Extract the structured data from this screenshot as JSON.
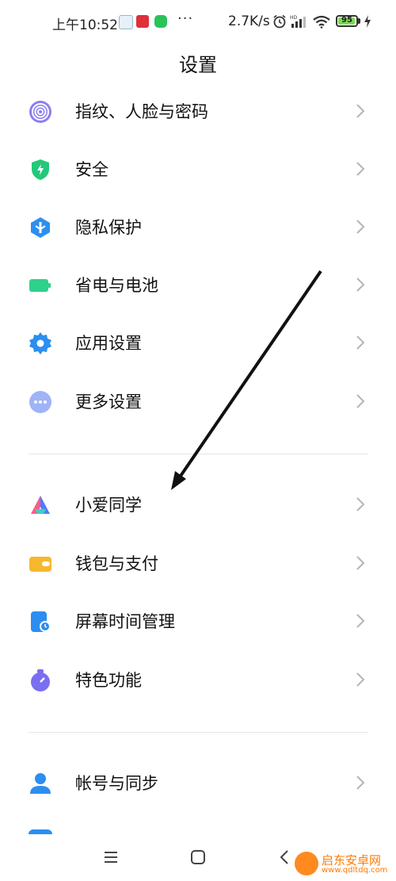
{
  "status_bar": {
    "time": "上午10:52",
    "net_speed": "2.7K/s",
    "dots": "···",
    "battery_level": "95",
    "battery_fraction": 0.95
  },
  "title": "设置",
  "groups": [
    {
      "items": [
        {
          "label": "指纹、人脸与密码",
          "icon": "fingerprint-icon",
          "color": "#7b6fe0"
        },
        {
          "label": "安全",
          "icon": "shield-icon",
          "color": "#23c87a"
        },
        {
          "label": "隐私保护",
          "icon": "privacy-icon",
          "color": "#2d8ff0"
        },
        {
          "label": "省电与电池",
          "icon": "battery-icon",
          "color": "#2ed18a"
        },
        {
          "label": "应用设置",
          "icon": "gear-icon",
          "color": "#2b8ef0"
        },
        {
          "label": "更多设置",
          "icon": "more-icon",
          "color": "#8fa5f5"
        }
      ]
    },
    {
      "items": [
        {
          "label": "小爱同学",
          "icon": "xiaoai-icon",
          "color": "#4f7cff"
        },
        {
          "label": "钱包与支付",
          "icon": "wallet-icon",
          "color": "#f5b82e"
        },
        {
          "label": "屏幕时间管理",
          "icon": "screen-time-icon",
          "color": "#2b8ef0"
        },
        {
          "label": "特色功能",
          "icon": "feature-icon",
          "color": "#7a6ff0"
        }
      ]
    },
    {
      "items": [
        {
          "label": "帐号与同步",
          "icon": "account-icon",
          "color": "#2b8ef0"
        }
      ]
    }
  ],
  "nav": {
    "menu_icon": "menu-icon",
    "home_icon": "home-icon",
    "back_icon": "back-icon"
  },
  "watermark": {
    "name": "启东安卓网",
    "url": "www.qdltdq.com"
  }
}
